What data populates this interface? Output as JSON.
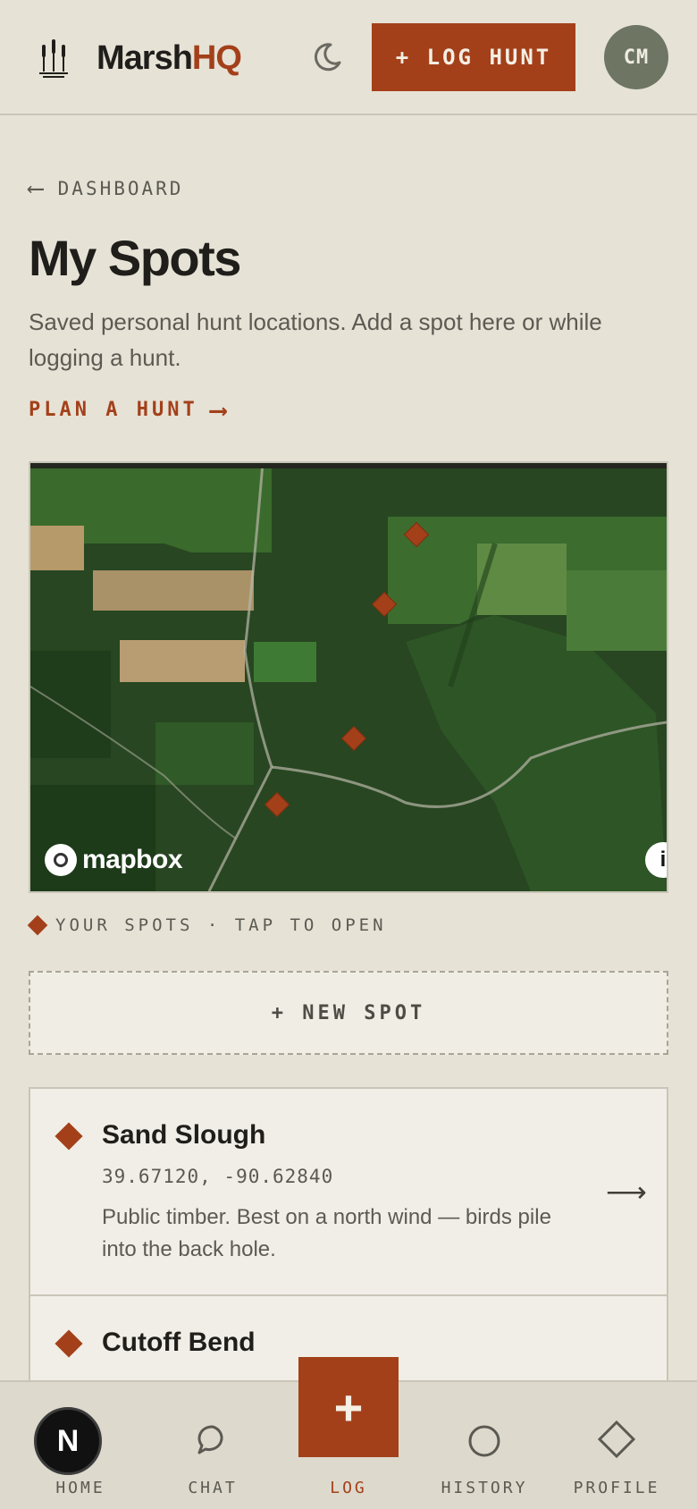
{
  "header": {
    "brand_main": "Marsh",
    "brand_accent": "HQ",
    "log_button": "+ LOG HUNT",
    "avatar_initials": "CM"
  },
  "page": {
    "back_label": "DASHBOARD",
    "title": "My Spots",
    "subtitle": "Saved personal hunt locations. Add a spot here or while logging a hunt.",
    "plan_link": "PLAN A HUNT"
  },
  "map": {
    "attribution": "mapbox",
    "info_icon": "i",
    "legend": "YOUR SPOTS · TAP TO OPEN"
  },
  "new_spot_button": "+ NEW SPOT",
  "spots": [
    {
      "name": "Sand Slough",
      "coords": "39.67120, -90.62840",
      "note": "Public timber. Best on a north wind — birds pile into the back hole."
    },
    {
      "name": "Cutoff Bend",
      "coords": "",
      "note": ""
    }
  ],
  "bottom_nav": {
    "home": "HOME",
    "chat": "CHAT",
    "log": "LOG",
    "history": "HISTORY",
    "profile": "PROFILE",
    "fab": "+",
    "badge": "N"
  },
  "colors": {
    "accent": "#a3401a",
    "background": "#e6e2d6",
    "avatar": "#6e7563"
  }
}
